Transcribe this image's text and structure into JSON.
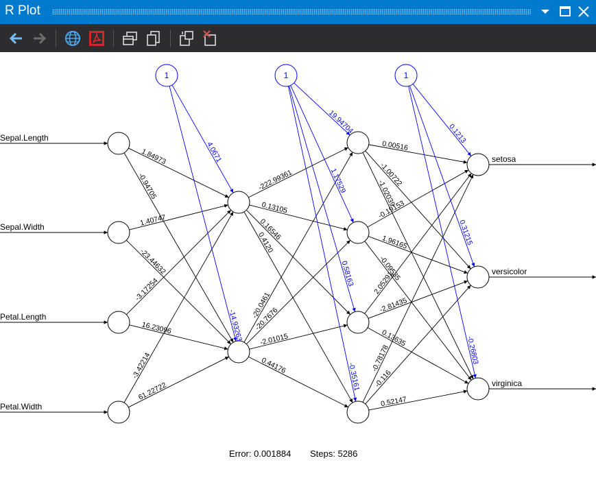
{
  "window": {
    "title": "R Plot"
  },
  "toolbar": {
    "buttons": [
      {
        "name": "back-arrow-icon"
      },
      {
        "name": "forward-arrow-icon"
      },
      {
        "name": "globe-icon"
      },
      {
        "name": "pdf-icon"
      },
      {
        "name": "copy-window-icon"
      },
      {
        "name": "copy-icon"
      },
      {
        "name": "export-icon"
      },
      {
        "name": "remove-icon"
      }
    ]
  },
  "colors": {
    "titlebar": "#007acc",
    "toolbar": "#2d2d30",
    "bias_edges": "#0000ff",
    "weight_edges": "#000000"
  },
  "network": {
    "inputs": [
      "Sepal.Length",
      "Sepal.Width",
      "Petal.Length",
      "Petal.Width"
    ],
    "outputs": [
      "setosa",
      "versicolor",
      "virginica"
    ],
    "bias_label": "1",
    "bias_weights": {
      "hidden1": [
        "4.0671",
        "-14.93263"
      ],
      "hidden2": [
        "19.94704",
        "1.17529",
        "0.58163",
        "-0.35161"
      ],
      "output": [
        "0.1213",
        "0.31215",
        "-0.26803"
      ]
    },
    "weights_in_h1": [
      [
        "1.84973",
        "-0.94705"
      ],
      [
        "1.40747",
        "-23.44632"
      ],
      [
        "-3.17254",
        "16.23096"
      ],
      [
        "-3.42214",
        "61.22722"
      ]
    ],
    "weights_h1_h2": [
      [
        "-222.99361",
        "0.13105",
        "0.16546",
        "0.4120"
      ],
      [
        "-20.0461",
        "-20.7676",
        "-2.01015",
        "0.44176"
      ]
    ],
    "weights_h2_out": [
      [
        "0.00516",
        "-1.00722",
        "-1.02039"
      ],
      [
        "-0.19153",
        "1.96165",
        "-0.09535"
      ],
      [
        "2.05291",
        "-2.81435",
        "0.13635"
      ],
      [
        "-0.78178",
        "-0.116",
        "0.52147"
      ]
    ]
  },
  "footer": {
    "error_label": "Error: 0.001884",
    "steps_label": "Steps: 5286"
  }
}
